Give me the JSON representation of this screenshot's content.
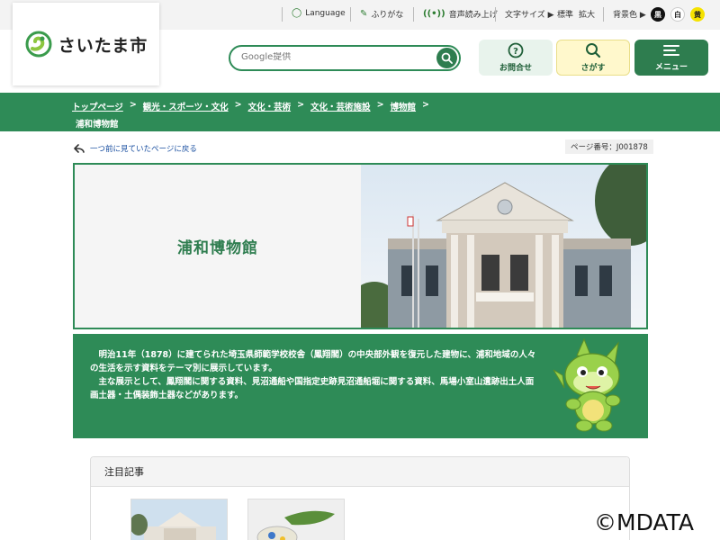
{
  "utility": {
    "language": "Language",
    "furigana": "ふりがな",
    "voice": "音声読み上げ",
    "text_size_label": "文字サイズ ▶",
    "text_standard": "標準",
    "text_large": "拡大",
    "bg_color_label": "背景色 ▶",
    "bg_black": "黒",
    "bg_white": "白",
    "bg_yellow": "黄"
  },
  "header": {
    "logo_text": "さいたま市",
    "search_placeholder": "Google提供",
    "inquiry_label": "お問合せ",
    "find_label": "さがす",
    "menu_label": "メニュー"
  },
  "breadcrumb": {
    "items": [
      "トップページ",
      "観光・スポーツ・文化",
      "文化・芸術",
      "文化・芸術施設",
      "博物館"
    ],
    "separator": ">",
    "current": "浦和博物館"
  },
  "page": {
    "back_link": "一つ前に見ていたページに戻る",
    "page_number": "ページ番号：J001878"
  },
  "hero": {
    "title": "浦和博物館"
  },
  "description": {
    "para1": "明治11年（1878）に建てられた埼玉県師範学校校舎（鳳翔閣）の中央部外観を復元した建物に、浦和地域の人々の生活を示す資料をテーマ別に展示しています。",
    "para2": "主な展示として、鳳翔閣に関する資料、見沼通船や国指定史跡見沼通船堀に関する資料、馬場小室山遺跡出土人面画土器・土偶装飾土器などがあります。"
  },
  "featured": {
    "heading": "注目記事"
  },
  "watermark": "©MDATA",
  "colors": {
    "brand_green": "#2e8b57",
    "dark_green": "#2e7d4f",
    "find_yellow": "#fff8cc"
  }
}
